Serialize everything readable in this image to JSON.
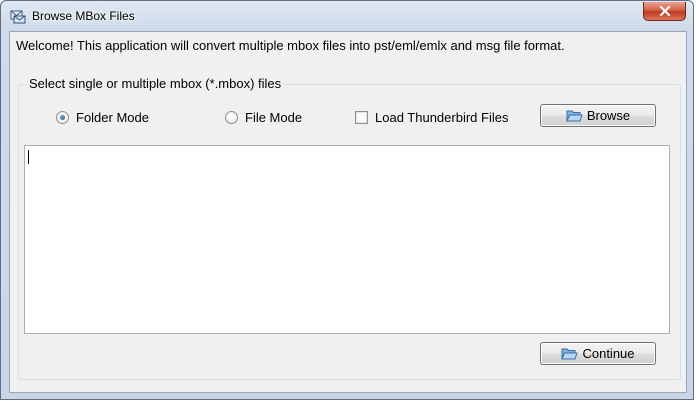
{
  "window": {
    "title": "Browse MBox Files",
    "close_icon": "close-icon",
    "app_icon": "mbox-app-icon"
  },
  "welcome_text": "Welcome! This application will convert multiple mbox files into pst/eml/emlx and msg file format.",
  "selection_group": {
    "legend": "Select single or multiple mbox (*.mbox) files",
    "folder_mode_label": "Folder Mode",
    "folder_mode_checked": true,
    "file_mode_label": "File Mode",
    "file_mode_checked": false,
    "thunderbird_label": "Load Thunderbird Files",
    "thunderbird_checked": false,
    "browse_label": "Browse",
    "file_list_text": ""
  },
  "continue_label": "Continue",
  "colors": {
    "close_button": "#c0391f",
    "radio_dot": "#1b4f86"
  }
}
